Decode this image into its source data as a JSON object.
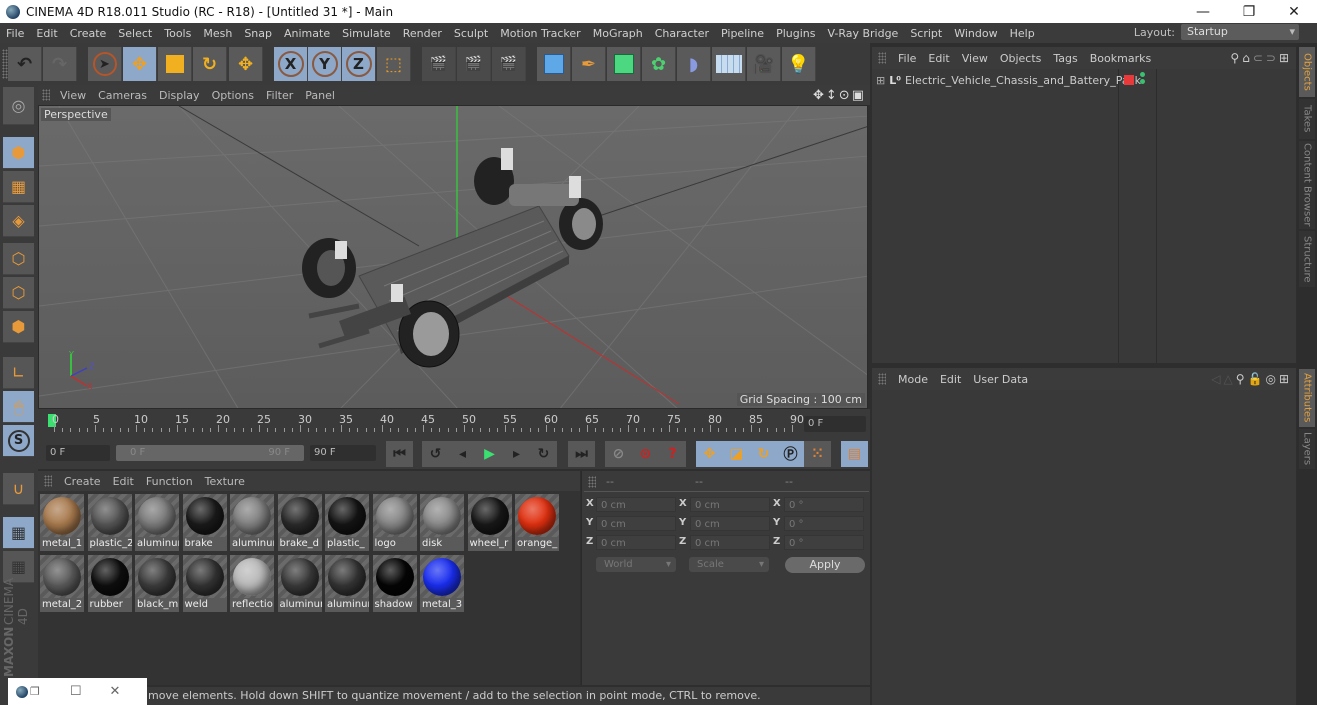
{
  "window": {
    "title": "CINEMA 4D R18.011 Studio (RC - R18) - [Untitled 31 *] - Main",
    "minimize_glyph": "—",
    "restore_glyph": "❐",
    "close_glyph": "✕"
  },
  "menubar": {
    "items": [
      "File",
      "Edit",
      "Create",
      "Select",
      "Tools",
      "Mesh",
      "Snap",
      "Animate",
      "Simulate",
      "Render",
      "Sculpt",
      "Motion Tracker",
      "MoGraph",
      "Character",
      "Pipeline",
      "Plugins",
      "V-Ray Bridge",
      "Script",
      "Window",
      "Help"
    ],
    "layout_label": "Layout:",
    "layout_value": "Startup"
  },
  "toolbar": {
    "axis_labels": [
      "X",
      "Y",
      "Z"
    ],
    "icons": [
      "undo-icon",
      "redo-icon",
      "live-selection-icon",
      "move-icon",
      "scale-icon",
      "rotate-icon",
      "recent-tool-icon",
      "x-axis-icon",
      "y-axis-icon",
      "z-axis-icon",
      "coordinate-system-icon",
      "render-view-icon",
      "render-to-picture-viewer-icon",
      "render-settings-icon",
      "cube-icon",
      "pen-spline-icon",
      "subdivision-icon",
      "cloner-icon",
      "bend-deformer-icon",
      "floor-icon",
      "camera-icon",
      "light-icon"
    ]
  },
  "viewport": {
    "menu": [
      "View",
      "Cameras",
      "Display",
      "Options",
      "Filter",
      "Panel"
    ],
    "camera_label": "Perspective",
    "grid_spacing": "Grid Spacing : 100 cm",
    "axis_labels": {
      "y": "Y",
      "z": "Z",
      "x": "X"
    }
  },
  "timeline": {
    "ticks": [
      "0",
      "5",
      "10",
      "15",
      "20",
      "25",
      "30",
      "35",
      "40",
      "45",
      "50",
      "55",
      "60",
      "65",
      "70",
      "75",
      "80",
      "85",
      "90"
    ],
    "current_frame": "0 F",
    "start_field": "0 F",
    "range_start": "0 F",
    "range_end": "90 F",
    "end_field": "90 F"
  },
  "materials": {
    "menu": [
      "Create",
      "Edit",
      "Function",
      "Texture"
    ],
    "items": [
      {
        "name": "metal_1",
        "color": "#a87a4e"
      },
      {
        "name": "plastic_2",
        "color": "#555555"
      },
      {
        "name": "aluminum",
        "color": "#7a7a7a"
      },
      {
        "name": "brake",
        "color": "#1a1a1a"
      },
      {
        "name": "aluminum",
        "color": "#808080"
      },
      {
        "name": "brake_d",
        "color": "#2a2a2a"
      },
      {
        "name": "plastic_",
        "color": "#141414"
      },
      {
        "name": "logo",
        "color": "#858585"
      },
      {
        "name": "disk",
        "color": "#8a8a8a"
      },
      {
        "name": "wheel_r",
        "color": "#181818"
      },
      {
        "name": "orange_",
        "color": "#e03010"
      },
      {
        "name": "metal_2",
        "color": "#5a5a5a"
      },
      {
        "name": "rubber",
        "color": "#0e0e0e"
      },
      {
        "name": "black_m",
        "color": "#3c3c3c"
      },
      {
        "name": "weld",
        "color": "#333333"
      },
      {
        "name": "reflectio",
        "color": "#b8b8b8"
      },
      {
        "name": "aluminum",
        "color": "#3a3a3a"
      },
      {
        "name": "aluminum",
        "color": "#343434"
      },
      {
        "name": "shadow",
        "color": "#050505"
      },
      {
        "name": "metal_3",
        "color": "#1a2ef0"
      }
    ]
  },
  "coordinates": {
    "headers": [
      "--",
      "--",
      "--"
    ],
    "rows": [
      {
        "axis": "X",
        "pos": "0 cm",
        "size": "0 cm",
        "rot": "0 °"
      },
      {
        "axis": "Y",
        "pos": "0 cm",
        "size": "0 cm",
        "rot": "0 °"
      },
      {
        "axis": "Z",
        "pos": "0 cm",
        "size": "0 cm",
        "rot": "0 °"
      }
    ],
    "mode_dropdown": "World",
    "size_dropdown": "Scale",
    "apply_label": "Apply"
  },
  "objects_panel": {
    "menu": [
      "File",
      "Edit",
      "View",
      "Objects",
      "Tags",
      "Bookmarks"
    ],
    "objects": [
      {
        "name": "Electric_Vehicle_Chassis_and_Battery_Pack",
        "tag_color": "#e83a3a",
        "status_color": "#3ac070"
      }
    ]
  },
  "attributes_panel": {
    "menu": [
      "Mode",
      "Edit",
      "User Data"
    ]
  },
  "right_tabs": {
    "top": [
      "Objects",
      "Takes",
      "Content Browser",
      "Structure"
    ],
    "bottom": [
      "Attributes",
      "Layers"
    ]
  },
  "branding": {
    "maxon": "MAXON",
    "cinema": "CINEMA 4D"
  },
  "status_bar": {
    "text": "move elements. Hold down SHIFT to quantize movement / add to the selection in point mode, CTRL to remove."
  }
}
